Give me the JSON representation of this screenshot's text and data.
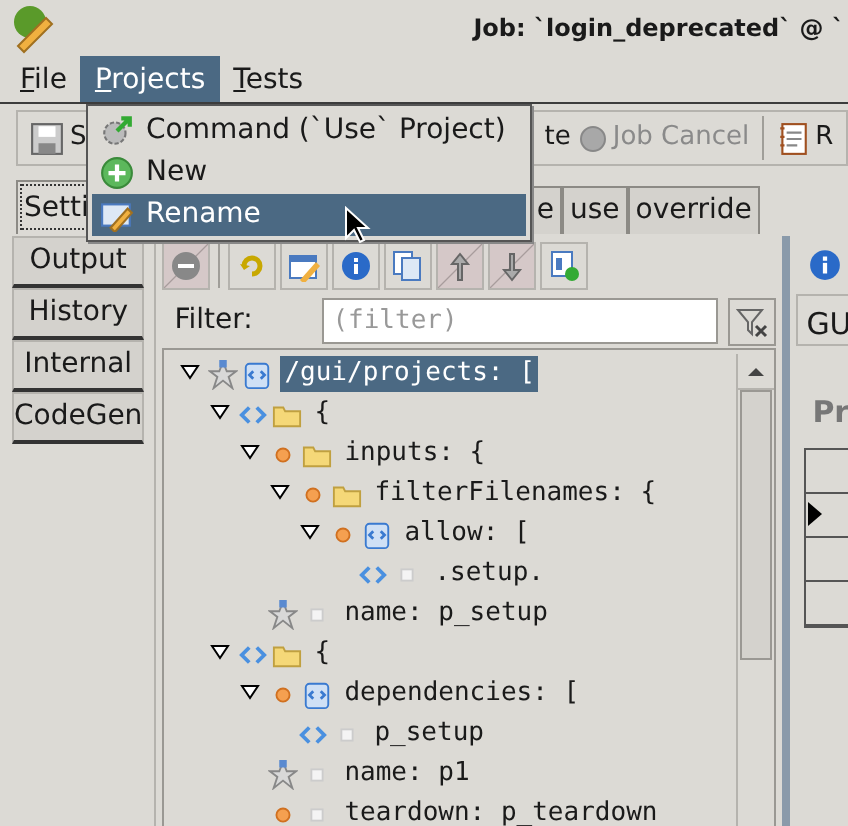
{
  "window": {
    "title": "Job: `login_deprecated` @ `"
  },
  "menu_bar": [
    {
      "label": "File",
      "selected": false
    },
    {
      "label": "Projects",
      "selected": true
    },
    {
      "label": "Tests",
      "selected": false
    }
  ],
  "projects_menu": [
    {
      "label": "Command (`Use` Project)",
      "selected": false
    },
    {
      "label": "New",
      "selected": false
    },
    {
      "label": "Rename",
      "selected": true
    }
  ],
  "toolbar": [
    {
      "kind": "button",
      "label": "S"
    },
    {
      "kind": "button",
      "label": "te"
    },
    {
      "kind": "radio",
      "label": "Job Cancel",
      "disabled": true,
      "checked": false
    },
    {
      "kind": "button",
      "label": "R"
    }
  ],
  "tabs": [
    {
      "label": "Setti",
      "selected": true
    },
    {
      "label": "e",
      "selected": false
    },
    {
      "label": "use",
      "selected": false
    },
    {
      "label": "override",
      "selected": false
    }
  ],
  "side_tabs": [
    {
      "label": "Output"
    },
    {
      "label": "History"
    },
    {
      "label": "Internal"
    },
    {
      "label": "CodeGen"
    }
  ],
  "tree_toolbar": [
    {
      "disabled": true
    },
    {
      "disabled": false
    },
    {
      "disabled": false
    },
    {
      "disabled": false
    },
    {
      "disabled": false
    },
    {
      "disabled": true
    },
    {
      "disabled": true
    },
    {
      "disabled": false
    }
  ],
  "filter": {
    "label": "Filter:",
    "placeholder": "(filter)"
  },
  "tree": [
    {
      "text": "/gui/projects: [",
      "kind": "star-array",
      "expanded": true,
      "selected": true,
      "children": [
        {
          "text": "{",
          "kind": "item-object",
          "expanded": true,
          "selected": false,
          "children": [
            {
              "text": "inputs: {",
              "kind": "key-object",
              "expanded": true,
              "selected": false,
              "children": [
                {
                  "text": "filterFilenames: {",
                  "kind": "key-object",
                  "expanded": true,
                  "selected": false,
                  "children": [
                    {
                      "text": "allow: [",
                      "kind": "key-array",
                      "expanded": true,
                      "selected": false,
                      "children": [
                        {
                          "text": ".setup.",
                          "kind": "item-value",
                          "selected": false
                        }
                      ]
                    }
                  ]
                }
              ]
            },
            {
              "text": "name: p_setup",
              "kind": "star-value",
              "selected": false
            }
          ]
        },
        {
          "text": "{",
          "kind": "item-object",
          "expanded": true,
          "selected": false,
          "children": [
            {
              "text": "dependencies: [",
              "kind": "key-array",
              "expanded": true,
              "selected": false,
              "children": [
                {
                  "text": "p_setup",
                  "kind": "item-value",
                  "selected": false
                }
              ]
            },
            {
              "text": "name: p1",
              "kind": "star-value",
              "selected": false
            },
            {
              "text": "teardown: p_teardown",
              "kind": "key-value",
              "selected": false
            }
          ]
        }
      ]
    }
  ],
  "right_panel": {
    "tab": "GU",
    "heading": "Pr"
  }
}
